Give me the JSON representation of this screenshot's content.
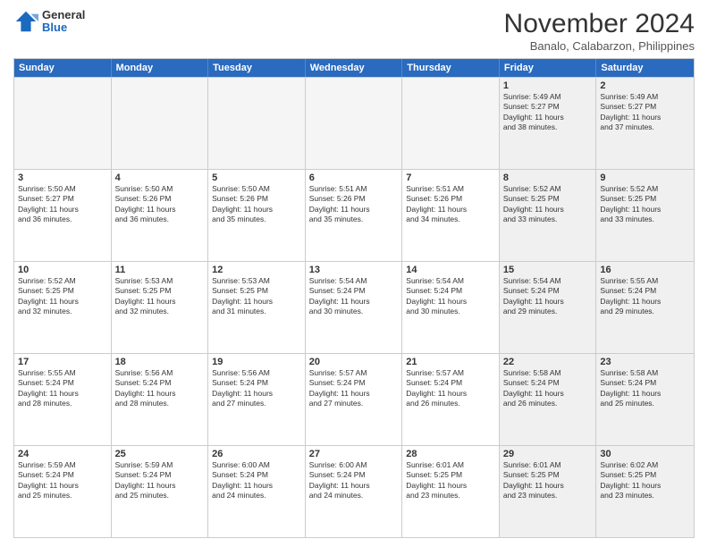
{
  "header": {
    "logo_general": "General",
    "logo_blue": "Blue",
    "month_title": "November 2024",
    "location": "Banalo, Calabarzon, Philippines"
  },
  "weekdays": [
    "Sunday",
    "Monday",
    "Tuesday",
    "Wednesday",
    "Thursday",
    "Friday",
    "Saturday"
  ],
  "weeks": [
    [
      {
        "day": "",
        "info": "",
        "empty": true
      },
      {
        "day": "",
        "info": "",
        "empty": true
      },
      {
        "day": "",
        "info": "",
        "empty": true
      },
      {
        "day": "",
        "info": "",
        "empty": true
      },
      {
        "day": "",
        "info": "",
        "empty": true
      },
      {
        "day": "1",
        "info": "Sunrise: 5:49 AM\nSunset: 5:27 PM\nDaylight: 11 hours\nand 38 minutes.",
        "empty": false
      },
      {
        "day": "2",
        "info": "Sunrise: 5:49 AM\nSunset: 5:27 PM\nDaylight: 11 hours\nand 37 minutes.",
        "empty": false
      }
    ],
    [
      {
        "day": "3",
        "info": "Sunrise: 5:50 AM\nSunset: 5:27 PM\nDaylight: 11 hours\nand 36 minutes.",
        "empty": false
      },
      {
        "day": "4",
        "info": "Sunrise: 5:50 AM\nSunset: 5:26 PM\nDaylight: 11 hours\nand 36 minutes.",
        "empty": false
      },
      {
        "day": "5",
        "info": "Sunrise: 5:50 AM\nSunset: 5:26 PM\nDaylight: 11 hours\nand 35 minutes.",
        "empty": false
      },
      {
        "day": "6",
        "info": "Sunrise: 5:51 AM\nSunset: 5:26 PM\nDaylight: 11 hours\nand 35 minutes.",
        "empty": false
      },
      {
        "day": "7",
        "info": "Sunrise: 5:51 AM\nSunset: 5:26 PM\nDaylight: 11 hours\nand 34 minutes.",
        "empty": false
      },
      {
        "day": "8",
        "info": "Sunrise: 5:52 AM\nSunset: 5:25 PM\nDaylight: 11 hours\nand 33 minutes.",
        "empty": false
      },
      {
        "day": "9",
        "info": "Sunrise: 5:52 AM\nSunset: 5:25 PM\nDaylight: 11 hours\nand 33 minutes.",
        "empty": false
      }
    ],
    [
      {
        "day": "10",
        "info": "Sunrise: 5:52 AM\nSunset: 5:25 PM\nDaylight: 11 hours\nand 32 minutes.",
        "empty": false
      },
      {
        "day": "11",
        "info": "Sunrise: 5:53 AM\nSunset: 5:25 PM\nDaylight: 11 hours\nand 32 minutes.",
        "empty": false
      },
      {
        "day": "12",
        "info": "Sunrise: 5:53 AM\nSunset: 5:25 PM\nDaylight: 11 hours\nand 31 minutes.",
        "empty": false
      },
      {
        "day": "13",
        "info": "Sunrise: 5:54 AM\nSunset: 5:24 PM\nDaylight: 11 hours\nand 30 minutes.",
        "empty": false
      },
      {
        "day": "14",
        "info": "Sunrise: 5:54 AM\nSunset: 5:24 PM\nDaylight: 11 hours\nand 30 minutes.",
        "empty": false
      },
      {
        "day": "15",
        "info": "Sunrise: 5:54 AM\nSunset: 5:24 PM\nDaylight: 11 hours\nand 29 minutes.",
        "empty": false
      },
      {
        "day": "16",
        "info": "Sunrise: 5:55 AM\nSunset: 5:24 PM\nDaylight: 11 hours\nand 29 minutes.",
        "empty": false
      }
    ],
    [
      {
        "day": "17",
        "info": "Sunrise: 5:55 AM\nSunset: 5:24 PM\nDaylight: 11 hours\nand 28 minutes.",
        "empty": false
      },
      {
        "day": "18",
        "info": "Sunrise: 5:56 AM\nSunset: 5:24 PM\nDaylight: 11 hours\nand 28 minutes.",
        "empty": false
      },
      {
        "day": "19",
        "info": "Sunrise: 5:56 AM\nSunset: 5:24 PM\nDaylight: 11 hours\nand 27 minutes.",
        "empty": false
      },
      {
        "day": "20",
        "info": "Sunrise: 5:57 AM\nSunset: 5:24 PM\nDaylight: 11 hours\nand 27 minutes.",
        "empty": false
      },
      {
        "day": "21",
        "info": "Sunrise: 5:57 AM\nSunset: 5:24 PM\nDaylight: 11 hours\nand 26 minutes.",
        "empty": false
      },
      {
        "day": "22",
        "info": "Sunrise: 5:58 AM\nSunset: 5:24 PM\nDaylight: 11 hours\nand 26 minutes.",
        "empty": false
      },
      {
        "day": "23",
        "info": "Sunrise: 5:58 AM\nSunset: 5:24 PM\nDaylight: 11 hours\nand 25 minutes.",
        "empty": false
      }
    ],
    [
      {
        "day": "24",
        "info": "Sunrise: 5:59 AM\nSunset: 5:24 PM\nDaylight: 11 hours\nand 25 minutes.",
        "empty": false
      },
      {
        "day": "25",
        "info": "Sunrise: 5:59 AM\nSunset: 5:24 PM\nDaylight: 11 hours\nand 25 minutes.",
        "empty": false
      },
      {
        "day": "26",
        "info": "Sunrise: 6:00 AM\nSunset: 5:24 PM\nDaylight: 11 hours\nand 24 minutes.",
        "empty": false
      },
      {
        "day": "27",
        "info": "Sunrise: 6:00 AM\nSunset: 5:24 PM\nDaylight: 11 hours\nand 24 minutes.",
        "empty": false
      },
      {
        "day": "28",
        "info": "Sunrise: 6:01 AM\nSunset: 5:25 PM\nDaylight: 11 hours\nand 23 minutes.",
        "empty": false
      },
      {
        "day": "29",
        "info": "Sunrise: 6:01 AM\nSunset: 5:25 PM\nDaylight: 11 hours\nand 23 minutes.",
        "empty": false
      },
      {
        "day": "30",
        "info": "Sunrise: 6:02 AM\nSunset: 5:25 PM\nDaylight: 11 hours\nand 23 minutes.",
        "empty": false
      }
    ]
  ]
}
